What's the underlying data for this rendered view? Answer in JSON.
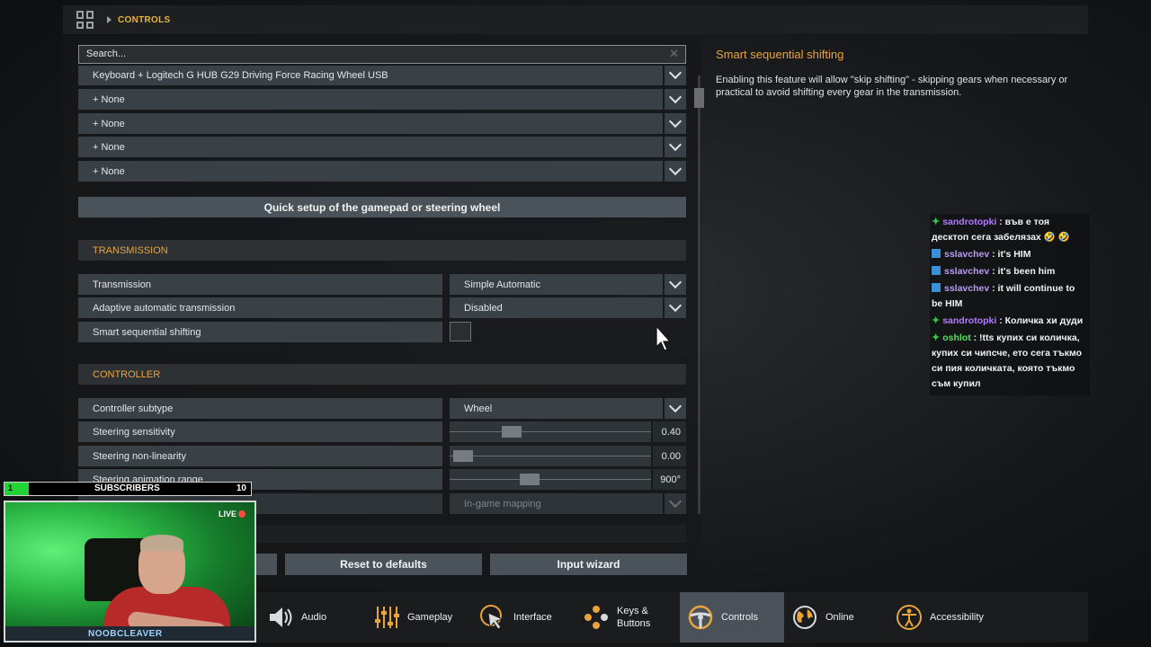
{
  "breadcrumb": {
    "section": "CONTROLS"
  },
  "search": {
    "placeholder": "Search..."
  },
  "devices": [
    {
      "label": "Keyboard + Logitech G HUB G29 Driving Force Racing Wheel USB"
    },
    {
      "label": "+ None"
    },
    {
      "label": "+ None"
    },
    {
      "label": "+ None"
    },
    {
      "label": "+ None"
    }
  ],
  "quick_setup": {
    "label": "Quick setup of the gamepad or steering wheel"
  },
  "transmission": {
    "title": "TRANSMISSION",
    "rows": [
      {
        "label": "Transmission",
        "value": "Simple Automatic"
      },
      {
        "label": "Adaptive automatic transmission",
        "value": "Disabled"
      },
      {
        "label": "Smart sequential shifting",
        "checked": false
      }
    ]
  },
  "controller": {
    "title": "CONTROLLER",
    "subtype": {
      "label": "Controller subtype",
      "value": "Wheel"
    },
    "sliders": [
      {
        "label": "Steering sensitivity",
        "value": "0.40",
        "level": 0.28
      },
      {
        "label": "Steering non-linearity",
        "value": "0.00",
        "level": 0.0
      },
      {
        "label": "Steering animation range",
        "value": "900°",
        "level": 0.38
      }
    ],
    "mapping": {
      "value": "In-game mapping"
    }
  },
  "buttons": {
    "reset": "Reset to defaults",
    "wizard": "Input wizard"
  },
  "info": {
    "title": "Smart sequential shifting",
    "description": "Enabling this feature will allow \"skip shifting\" - skipping gears when necessary or practical to avoid shifting every gear in the transmission."
  },
  "chat": [
    {
      "badge": "green",
      "user": "sandrotopki",
      "message": ": във е тоя десктоп сега забелязах 🤣 🤣"
    },
    {
      "badge": "blue",
      "user": "sslavchev",
      "message": ": it's HIM"
    },
    {
      "badge": "blue",
      "user": "sslavchev",
      "message": ": it's been him"
    },
    {
      "badge": "blue",
      "user": "sslavchev",
      "message": ": it will continue to be HIM"
    },
    {
      "badge": "green",
      "user": "sandrotopki",
      "message": ": Количка хи дуди"
    },
    {
      "badge": "green",
      "user": "oshlot",
      "message": ": !tts купих си количка, купих си чипсче, ето сега тъкмо си пия количката, която тъкмо съм купил"
    }
  ],
  "overlay": {
    "subs_current": "1",
    "subs_label": "SUBSCRIBERS",
    "subs_goal": "10",
    "subs_progress": 0.1,
    "live": "LIVE",
    "streamer": "NOOBCLEAVER"
  },
  "tabs": [
    {
      "label": "Audio",
      "icon": "speaker-icon",
      "active": false
    },
    {
      "label": "Gameplay",
      "icon": "sliders-icon",
      "active": false
    },
    {
      "label": "Interface",
      "icon": "cursor-icon",
      "active": false
    },
    {
      "label": "Keys & Buttons",
      "icon": "dots-icon",
      "active": false
    },
    {
      "label": "Controls",
      "icon": "steering-wheel-icon",
      "active": true
    },
    {
      "label": "Online",
      "icon": "globe-icon",
      "active": false
    },
    {
      "label": "Accessibility",
      "icon": "person-icon",
      "active": false
    }
  ]
}
